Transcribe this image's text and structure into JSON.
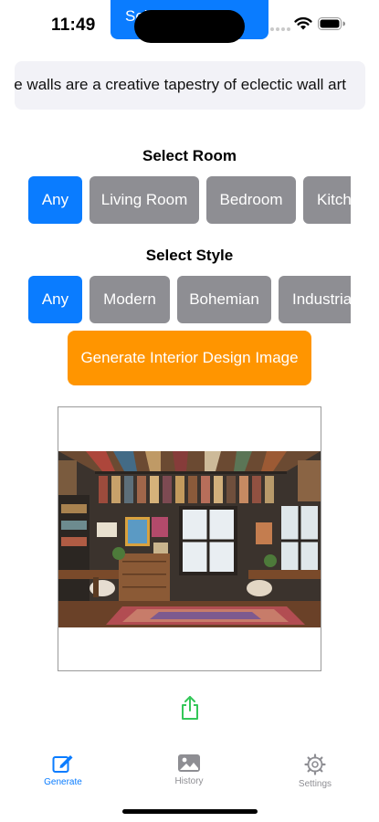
{
  "status_bar": {
    "time": "11:49",
    "top_button_label": "Select Image"
  },
  "prompt": {
    "value": "e walls are a creative tapestry of eclectic wall art"
  },
  "room_section": {
    "title": "Select Room",
    "options": [
      "Any",
      "Living Room",
      "Bedroom",
      "Kitchen"
    ],
    "selected": "Any"
  },
  "style_section": {
    "title": "Select Style",
    "options": [
      "Any",
      "Modern",
      "Bohemian",
      "Industrial"
    ],
    "selected": "Any"
  },
  "generate_button": {
    "label": "Generate Interior Design Image"
  },
  "tab_bar": {
    "tabs": [
      {
        "label": "Generate",
        "icon": "compose-icon",
        "active": true
      },
      {
        "label": "History",
        "icon": "photo-icon",
        "active": false
      },
      {
        "label": "Settings",
        "icon": "gear-icon",
        "active": false
      }
    ]
  },
  "colors": {
    "accent_blue": "#0a7cff",
    "chip_gray": "#8e8e93",
    "generate_orange": "#ff9500",
    "share_green": "#34c759"
  }
}
